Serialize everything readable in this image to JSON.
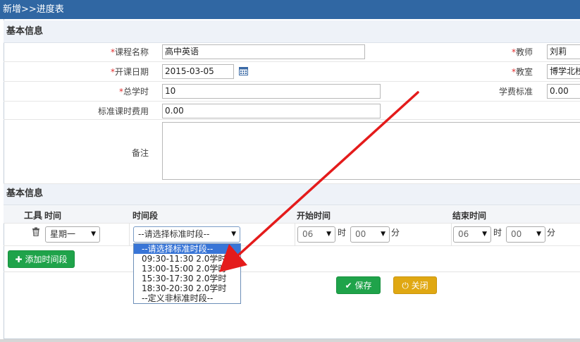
{
  "window": {
    "title": "新增>>进度表"
  },
  "section1": {
    "title": "基本信息"
  },
  "form": {
    "course_name": {
      "label": "课程名称",
      "value": "高中英语"
    },
    "teacher": {
      "label": "教师",
      "value": "刘莉"
    },
    "start_date": {
      "label": "开课日期",
      "value": "2015-03-05"
    },
    "classroom": {
      "label": "教室",
      "value": "博学北校"
    },
    "total_hours": {
      "label": "总学时",
      "value": "10"
    },
    "fee_standard": {
      "label": "学费标准",
      "value": "0.00"
    },
    "std_hour_fee": {
      "label": "标准课时费用",
      "value": "0.00"
    },
    "remark": {
      "label": "备注",
      "value": ""
    }
  },
  "section2": {
    "title": "基本信息"
  },
  "schedule": {
    "headers": {
      "tools": "工具",
      "time": "时间",
      "slot": "时间段",
      "start": "开始时间",
      "end": "结束时间"
    },
    "row": {
      "weekday": "星期一",
      "slot": "--请选择标准时段--",
      "start_hour": "06",
      "start_min": "00",
      "end_hour": "06",
      "end_min": "00",
      "hour_unit": "时",
      "min_unit": "分"
    },
    "dropdown_options": [
      "--请选择标准时段--",
      "09:30-11:30 2.0学时",
      "13:00-15:00 2.0学时",
      "15:30-17:30 2.0学时",
      "18:30-20:30 2.0学时",
      "--定义非标准时段--"
    ],
    "add_button": "添加时间段"
  },
  "actions": {
    "save": "保存",
    "close": "关闭"
  },
  "colors": {
    "titlebar": "#3067a3",
    "green": "#1fa34a",
    "gold": "#e0a812",
    "arrow": "#e41b1b",
    "selection": "#3875d7"
  }
}
